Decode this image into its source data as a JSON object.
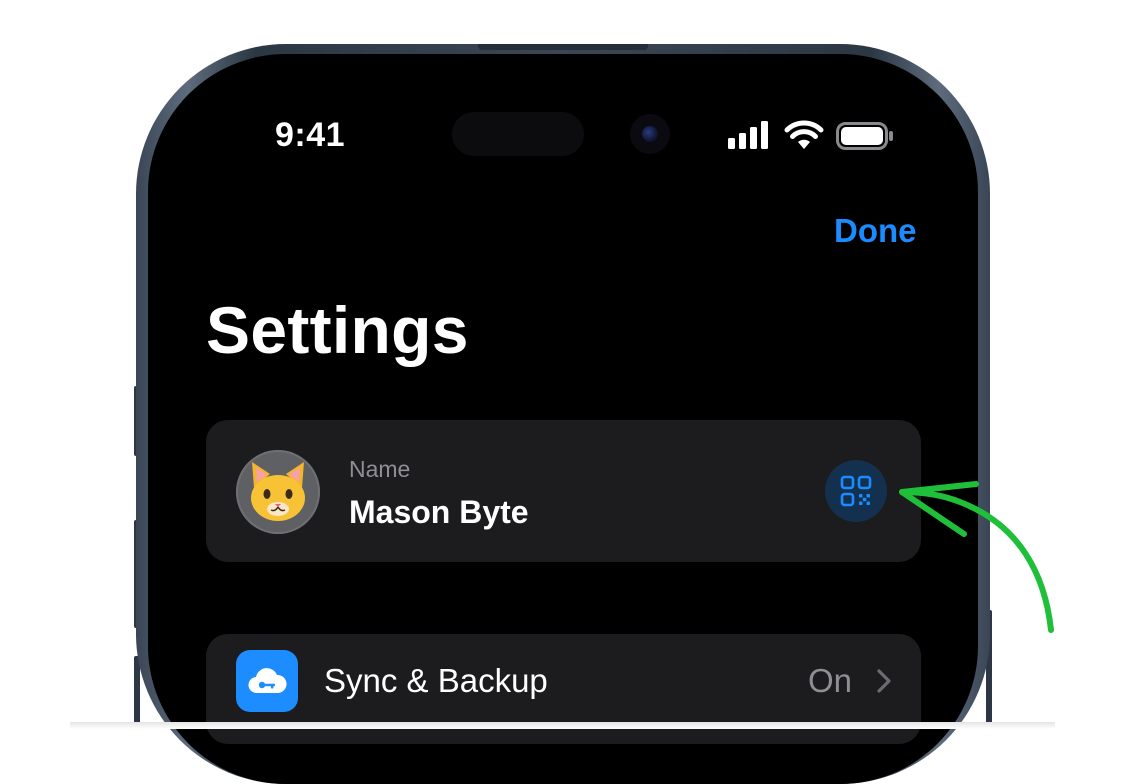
{
  "status_bar": {
    "time": "9:41",
    "icons": [
      "signal-icon",
      "wifi-icon",
      "battery-icon"
    ]
  },
  "header": {
    "done_label": "Done",
    "title": "Settings"
  },
  "profile": {
    "name_label": "Name",
    "name_value": "Mason Byte",
    "avatar": "cat-face-emoji",
    "action_icon": "qr-code-icon"
  },
  "settings_rows": [
    {
      "label": "Sync & Backup",
      "value": "On",
      "icon": "cloud-key-icon"
    }
  ],
  "annotation": {
    "type": "hand-drawn-arrow",
    "points_to": "qr-code-button"
  },
  "colors": {
    "accent": "#1a8cff",
    "background": "#000000",
    "card": "#1c1c1e",
    "secondary_text": "#8e8e93",
    "annotation": "#1fbf3a",
    "qr_button_bg": "#14304f"
  }
}
